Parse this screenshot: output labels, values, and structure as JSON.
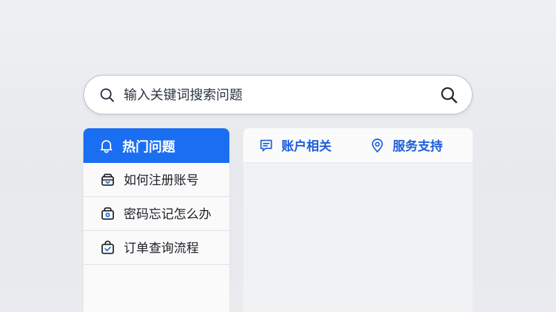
{
  "search": {
    "placeholder": "输入关键词搜索问题",
    "icon": "search-icon",
    "button_icon": "search-icon"
  },
  "left_panel": {
    "header": {
      "label": "热门问题",
      "icon": "bell-icon"
    },
    "items": [
      {
        "label": "如何注册账号",
        "icon": "inbox-icon"
      },
      {
        "label": "密码忘记怎么办",
        "icon": "lock-box-icon"
      },
      {
        "label": "订单查询流程",
        "icon": "bag-check-icon"
      }
    ]
  },
  "right_panel": {
    "tabs": [
      {
        "label": "账户相关",
        "icon": "message-icon"
      },
      {
        "label": "服务支持",
        "icon": "location-pin-icon"
      }
    ]
  },
  "colors": {
    "accent": "#1a6ef2",
    "tab_text": "#1b5fd9",
    "text": "#1c1f24"
  }
}
